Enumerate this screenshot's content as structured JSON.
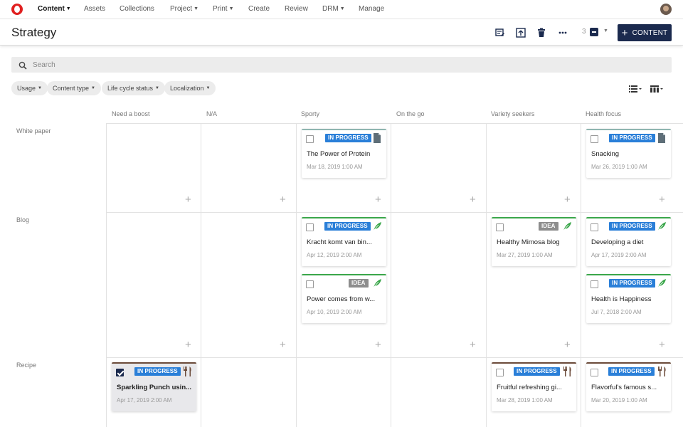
{
  "nav": {
    "items": [
      {
        "label": "Content",
        "caret": true,
        "active": true
      },
      {
        "label": "Assets",
        "caret": false
      },
      {
        "label": "Collections",
        "caret": false
      },
      {
        "label": "Project",
        "caret": true
      },
      {
        "label": "Print",
        "caret": true
      },
      {
        "label": "Create",
        "caret": false
      },
      {
        "label": "Review",
        "caret": false
      },
      {
        "label": "DRM",
        "caret": true
      },
      {
        "label": "Manage",
        "caret": false
      }
    ]
  },
  "header": {
    "title": "Strategy",
    "selected_count": "3",
    "new_content_label": "CONTENT"
  },
  "search": {
    "placeholder": "Search"
  },
  "filters": [
    "Usage",
    "Content type",
    "Life cycle status",
    "Localization"
  ],
  "board": {
    "columns": [
      "Need a boost",
      "N/A",
      "Sporty",
      "On the go",
      "Variety seekers",
      "Health focus"
    ],
    "rows": [
      "White paper",
      "Blog",
      "Recipe"
    ],
    "cards": [
      {
        "row": "White paper",
        "column": "Sporty",
        "status": "IN PROGRESS",
        "icon": "document-icon",
        "title": "The Power of Protein",
        "date": "Mar 18, 2019 1:00 AM",
        "checked": false
      },
      {
        "row": "White paper",
        "column": "Health focus",
        "status": "IN PROGRESS",
        "icon": "document-icon",
        "title": "Snacking",
        "date": "Mar 26, 2019 1:00 AM",
        "checked": false
      },
      {
        "row": "Blog",
        "column": "Sporty",
        "status": "IN PROGRESS",
        "icon": "feather-icon",
        "title": "Kracht komt van bin...",
        "date": "Apr 12, 2019 2:00 AM",
        "checked": false
      },
      {
        "row": "Blog",
        "column": "Sporty",
        "status": "IDEA",
        "icon": "feather-icon",
        "title": "Power comes from w...",
        "date": "Apr 10, 2019 2:00 AM",
        "checked": false
      },
      {
        "row": "Blog",
        "column": "Variety seekers",
        "status": "IDEA",
        "icon": "feather-icon",
        "title": "Healthy Mimosa blog",
        "date": "Mar 27, 2019 1:00 AM",
        "checked": false
      },
      {
        "row": "Blog",
        "column": "Health focus",
        "status": "IN PROGRESS",
        "icon": "feather-icon",
        "title": "Developing a diet",
        "date": "Apr 17, 2019 2:00 AM",
        "checked": false
      },
      {
        "row": "Blog",
        "column": "Health focus",
        "status": "IN PROGRESS",
        "icon": "feather-icon",
        "title": "Health is Happiness",
        "date": "Jul 7, 2018 2:00 AM",
        "checked": false
      },
      {
        "row": "Recipe",
        "column": "Need a boost",
        "status": "IN PROGRESS",
        "icon": "fork-knife-icon",
        "title": "Sparkling Punch usin...",
        "date": "Apr 17, 2019 2:00 AM",
        "checked": true
      },
      {
        "row": "Recipe",
        "column": "Variety seekers",
        "status": "IN PROGRESS",
        "icon": "fork-knife-icon",
        "title": "Fruitful refreshing gi...",
        "date": "Mar 28, 2019 1:00 AM",
        "checked": false
      },
      {
        "row": "Recipe",
        "column": "Health focus",
        "status": "IN PROGRESS",
        "icon": "fork-knife-icon",
        "title": "Flavorful's famous s...",
        "date": "Mar 20, 2019 1:00 AM",
        "checked": false
      }
    ]
  },
  "colors": {
    "brand_red": "#e02020",
    "navy": "#1b2a4e",
    "in_progress": "#2a7fd8",
    "idea": "#8d8d8d",
    "feather_green": "#3aa64a",
    "doc_slate": "#5e6e78",
    "fork_brown": "#6b4b3a"
  }
}
